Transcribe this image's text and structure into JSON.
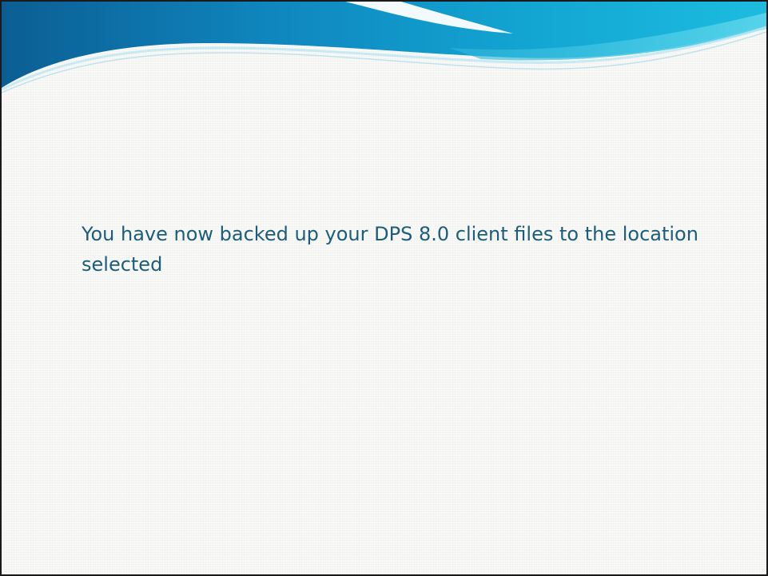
{
  "slide": {
    "body_text": "You have now backed up your DPS 8.0 client files to the location selected"
  },
  "colors": {
    "text": "#1b5d7a",
    "header_dark": "#0b6fa8",
    "header_mid": "#11a9d4",
    "header_light": "#36c7e2",
    "background": "#f9faf8"
  }
}
